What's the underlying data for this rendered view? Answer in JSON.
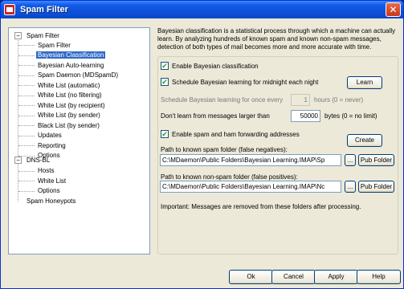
{
  "window": {
    "title": "Spam Filter",
    "close_label": "✕"
  },
  "tree": {
    "items": [
      {
        "label": "Spam Filter",
        "expander": "−"
      },
      {
        "label": "Spam Filter"
      },
      {
        "label": "Bayesian Classification",
        "selected": true
      },
      {
        "label": "Bayesian Auto-learning"
      },
      {
        "label": "Spam Daemon (MDSpamD)"
      },
      {
        "label": "White List (automatic)"
      },
      {
        "label": "White List (no filtering)"
      },
      {
        "label": "White List (by recipient)"
      },
      {
        "label": "White List (by sender)"
      },
      {
        "label": "Black List (by sender)"
      },
      {
        "label": "Updates"
      },
      {
        "label": "Reporting"
      },
      {
        "label": "Options"
      },
      {
        "label": "DNS-BL",
        "expander": "−"
      },
      {
        "label": "Hosts"
      },
      {
        "label": "White List"
      },
      {
        "label": "Options"
      },
      {
        "label": "Spam Honeypots"
      }
    ]
  },
  "panel": {
    "description": "Bayesian classification is a statistical process through which a machine can actually learn.  By analyzing hundreds of known spam and known non-spam messages, detection of both types of mail becomes more and more accurate with time.",
    "enable_bayesian": {
      "label": "Enable Bayesian classification",
      "checked": true
    },
    "schedule_midnight": {
      "label": "Schedule Bayesian learning for midnight each night",
      "checked": true
    },
    "learn_button": "Learn",
    "schedule_every": {
      "label": "Schedule Bayesian learning for once every",
      "value": "1",
      "suffix": "hours (0 = never)"
    },
    "dont_learn": {
      "label": "Don't learn from messages larger than",
      "value": "50000",
      "suffix": "bytes (0 = no limit)"
    },
    "enable_forwarding": {
      "label": "Enable spam and ham forwarding addresses",
      "checked": true
    },
    "create_button": "Create",
    "spam_folder": {
      "label": "Path to known spam folder (false negatives):",
      "value": "C:\\MDaemon\\Public Folders\\Bayesian Learning.IMAP\\Sp",
      "browse": "...",
      "pub_folder": "Pub Folder"
    },
    "nonspam_folder": {
      "label": "Path to known non-spam folder (false positives):",
      "value": "C:\\MDaemon\\Public Folders\\Bayesian Learning.IMAP\\Nc",
      "browse": "...",
      "pub_folder": "Pub Folder"
    },
    "important_note": "Important:  Messages are removed from these folders after processing."
  },
  "footer": {
    "ok": "Ok",
    "cancel": "Cancel",
    "apply": "Apply",
    "help": "Help"
  },
  "colors": {
    "title_bar": "#0c4fd6",
    "selection": "#316ac5",
    "dialog_bg": "#ece9d8"
  }
}
